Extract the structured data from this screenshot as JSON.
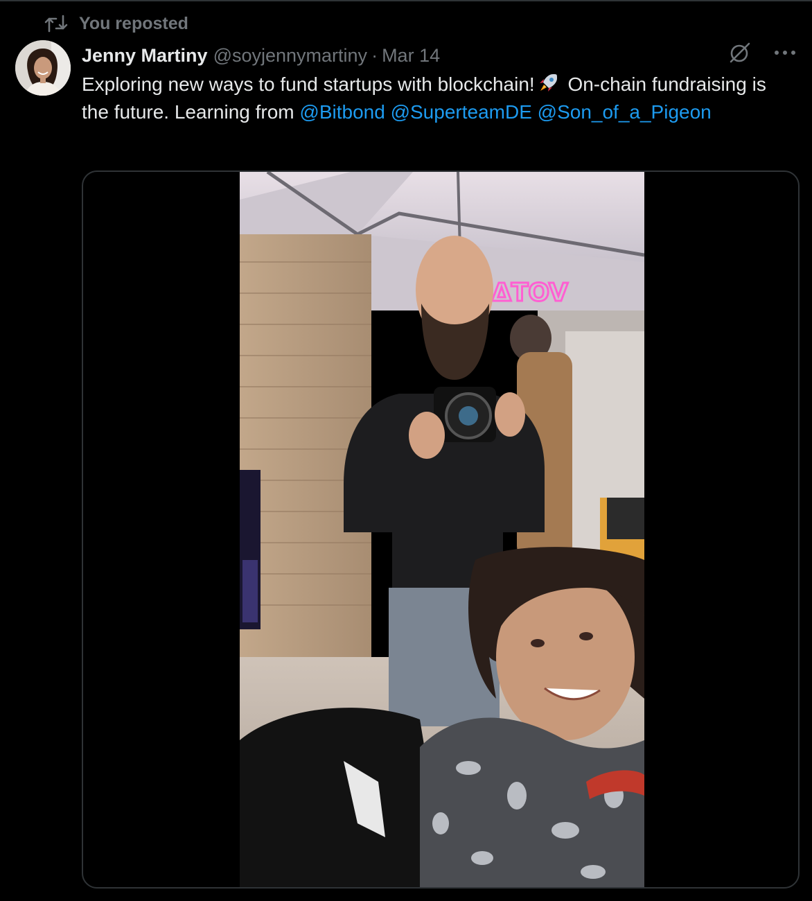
{
  "repost": {
    "label": "You reposted",
    "icon": "repost-icon"
  },
  "author": {
    "name": "Jenny Martiny",
    "handle": "@soyjennymartiny",
    "separator": "·",
    "date": "Mar 14",
    "avatar_icon": "avatar-photo"
  },
  "actions": {
    "grok_icon": "grok-icon",
    "more_icon": "more-icon"
  },
  "post": {
    "text_part1": "Exploring new ways to fund startups with blockchain!",
    "emoji": "rocket-emoji",
    "text_part2": "On-chain fundraising is the future. Learning from",
    "mentions": [
      "@Bitbond",
      "@SuperteamDE",
      "@Son_of_a_Pigeon"
    ]
  },
  "media": {
    "type": "video",
    "sign_text": "ΔTOV"
  },
  "colors": {
    "background": "#000000",
    "text": "#e7e9ea",
    "secondary": "#71767b",
    "link": "#1d9bf0",
    "border": "#2f3336"
  }
}
